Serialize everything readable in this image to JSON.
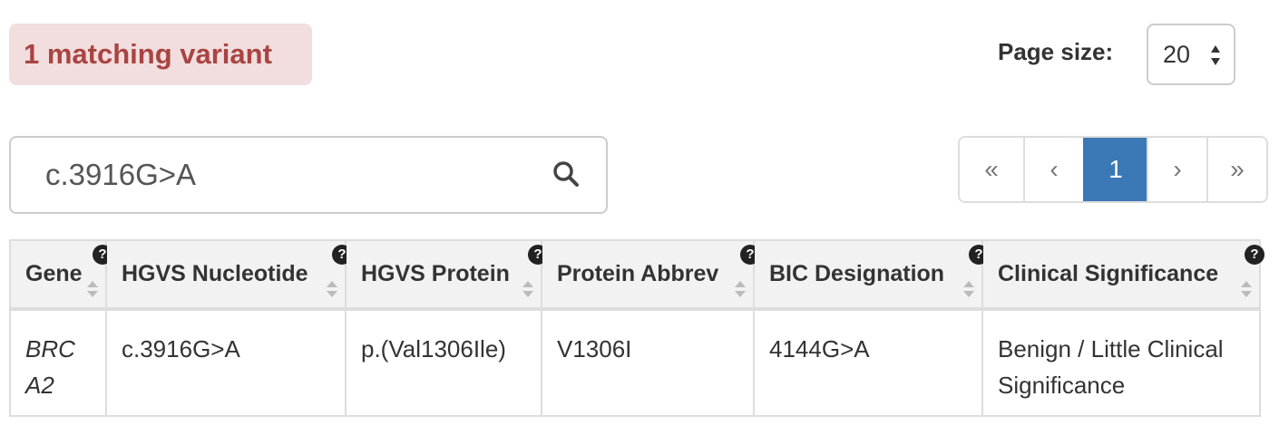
{
  "results": {
    "count_label": "1 matching variant"
  },
  "page_size": {
    "label": "Page size:",
    "value": "20"
  },
  "search": {
    "value": "c.3916G>A",
    "placeholder": ""
  },
  "pagination": {
    "first": "«",
    "prev": "‹",
    "current": "1",
    "next": "›",
    "last": "»"
  },
  "table": {
    "headers": [
      "Gene",
      "HGVS Nucleotide",
      "HGVS Protein",
      "Protein Abbrev",
      "BIC Designation",
      "Clinical Significance"
    ],
    "rows": [
      {
        "gene": "BRCA2",
        "hgvs_nucleotide": "c.3916G>A",
        "hgvs_protein": "p.(Val1306Ile)",
        "protein_abbrev": "V1306I",
        "bic_designation": "4144G>A",
        "clinical_significance": "Benign / Little Clinical Significance"
      }
    ]
  },
  "icons": {
    "help": "?"
  },
  "colors": {
    "badge_bg": "#f2dede",
    "badge_text": "#a94442",
    "active_page": "#3b78b6",
    "link": "#337ab7"
  }
}
